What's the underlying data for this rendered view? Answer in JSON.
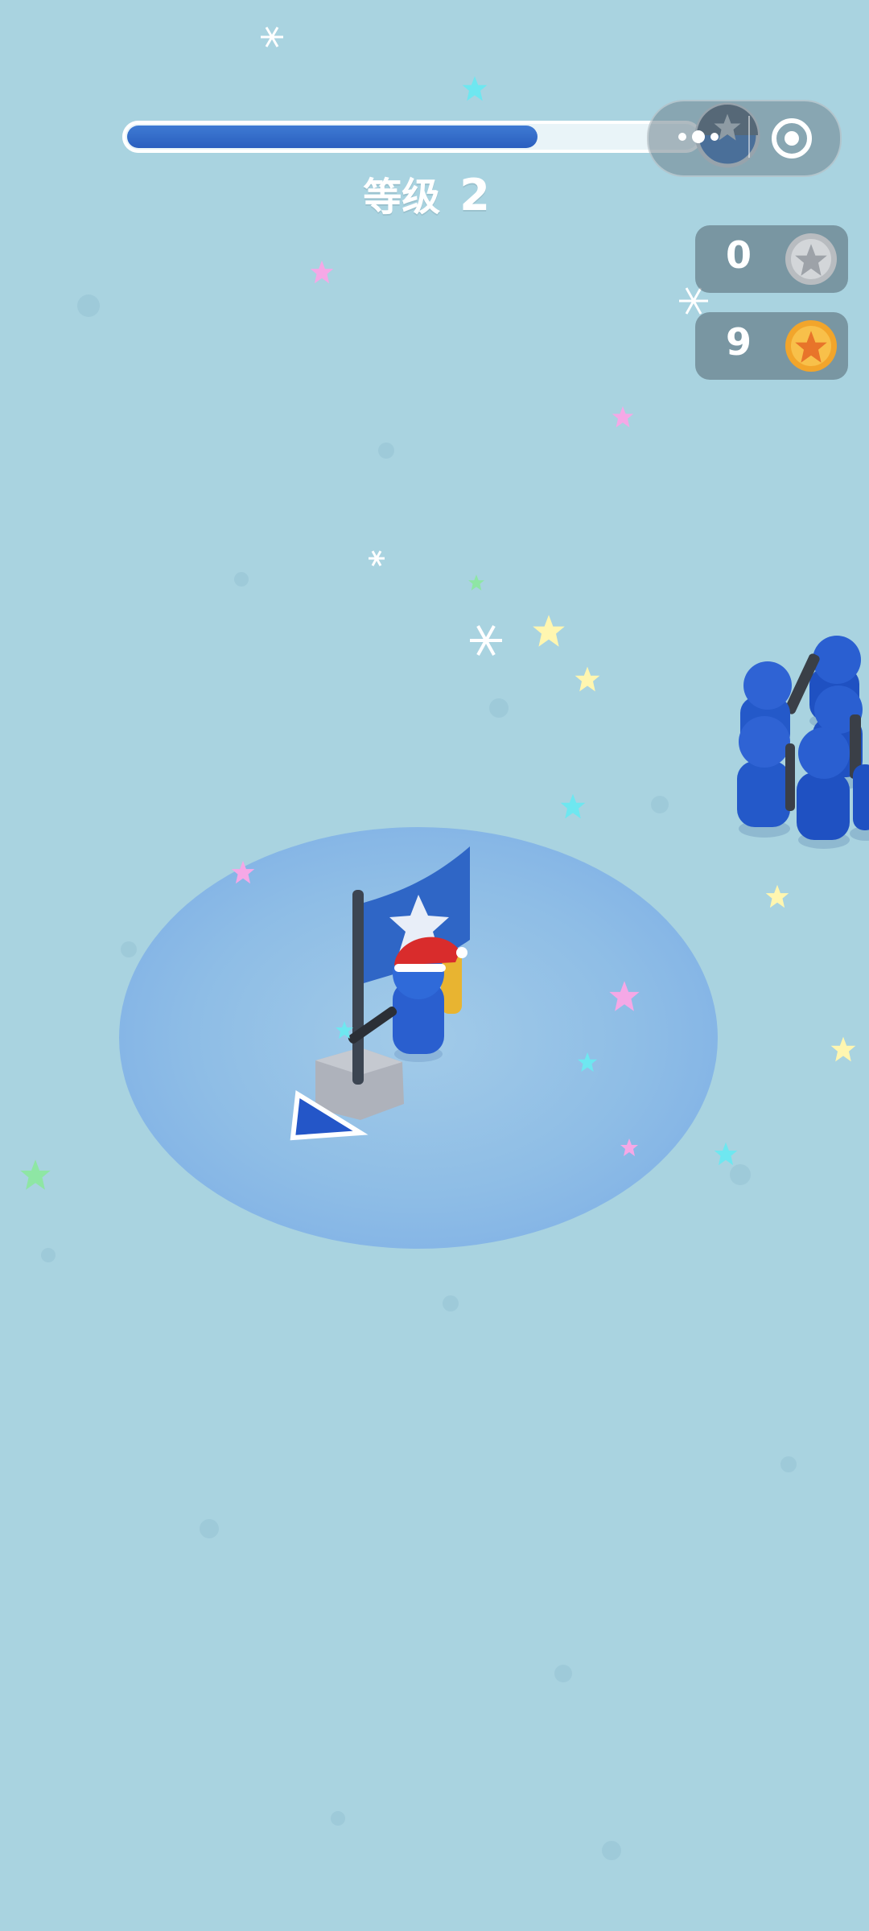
{
  "hud": {
    "level_label": "等级",
    "level_number": "2",
    "level_progress": 0.72
  },
  "counters": {
    "silver": "0",
    "gold": "9"
  },
  "colors": {
    "ground": "#a9d3e0",
    "team_blue": "#2456c8",
    "progress_fill": "#2f67c7",
    "gold": "#f2a52b",
    "silver": "#b8bcc0"
  },
  "icons": {
    "menu": "more-dots-icon",
    "close": "target-close-icon",
    "silver": "silver-star-coin-icon",
    "gold": "gold-star-coin-icon"
  }
}
